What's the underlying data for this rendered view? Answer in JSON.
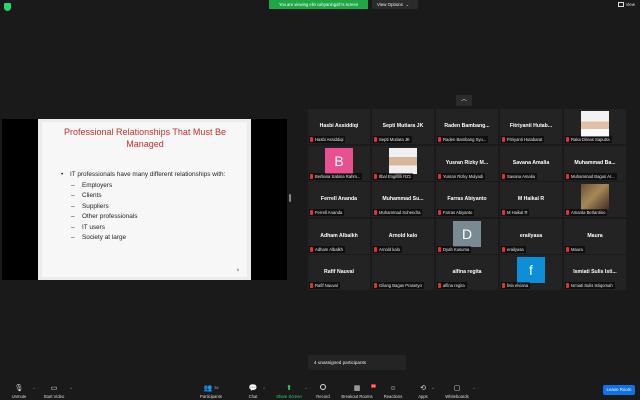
{
  "top": {
    "viewing_banner": "You are viewing elin cahyaningsih's screen",
    "view_options": "View Options",
    "view": "View"
  },
  "slide": {
    "title": "Professional Relationships That Must Be Managed",
    "bullet": "IT professionals have many different relationships with:",
    "items": [
      "Employers",
      "Clients",
      "Suppliers",
      "Other professionals",
      "IT users",
      "Society at large"
    ],
    "page_number": "6"
  },
  "tiles": [
    {
      "name": "Hasbi Assiddiqi",
      "label": "Hasbi Assiddiqi"
    },
    {
      "name": "Septi Mutiara JK",
      "label": "Septi Mutiara JK"
    },
    {
      "name": "Raden Bambang...",
      "label": "Raden Bambang Syu..."
    },
    {
      "name": "Fitriyanti Hutab...",
      "label": "Fitriyanti Hutabarat"
    },
    {
      "name": "",
      "label": "Raka Dimas Saputra",
      "avatar": "photo"
    },
    {
      "name": "",
      "label": "Berliana Sabina Rahm...",
      "avatar": "initial",
      "initial": "B"
    },
    {
      "name": "",
      "label": "Ilbal Engilfilli RZ1",
      "avatar": "photo"
    },
    {
      "name": "Yusran Rizky M...",
      "label": "Yusran Rizky Mulyadi"
    },
    {
      "name": "Savana Amalia",
      "label": "Savana Amalia"
    },
    {
      "name": "Muhammad Ba...",
      "label": "Muhammad Bagus Ar..."
    },
    {
      "name": "Ferrell Ananda",
      "label": "Ferrell Ananda"
    },
    {
      "name": "Muhammad Su...",
      "label": "Muhammad Suhendra"
    },
    {
      "name": "Farras Abiyanto",
      "label": "Farras Abiyanto"
    },
    {
      "name": "M Haikal R",
      "label": "M Haikal R"
    },
    {
      "name": "",
      "label": "Amanta Berlantino",
      "avatar": "photo"
    },
    {
      "name": "Adham Albalkh",
      "label": "Adham Albalkh"
    },
    {
      "name": "Arnold kalo",
      "label": "Arnold kalo"
    },
    {
      "name": "",
      "label": "Dyah Kusuma",
      "avatar": "initial",
      "initial": "D"
    },
    {
      "name": "erailyasa",
      "label": "erailyasa"
    },
    {
      "name": "Maura",
      "label": "Maura"
    },
    {
      "name": "Rafif Nauval",
      "label": "Rafif Nauval"
    },
    {
      "name": "",
      "label": "Gilang Bagas Prasetyo"
    },
    {
      "name": "alfina regita",
      "label": "alfina regita"
    },
    {
      "name": "",
      "label": "fela elviana",
      "avatar": "initial",
      "initial": "f"
    },
    {
      "name": "Ismiati Sulis Isti...",
      "label": "Ismiati Sulis Istiqomah"
    }
  ],
  "unassigned": "4 unassigned participants",
  "toolbar": {
    "unmute": "Unmute",
    "start_video": "Start Video",
    "participants": "Participants",
    "participants_count": "38",
    "chat": "Chat",
    "share_screen": "Share Screen",
    "record": "Record",
    "breakout_rooms": "Breakout Rooms",
    "breakout_badge": "19",
    "reactions": "Reactions",
    "apps": "Apps",
    "whiteboards": "Whiteboards",
    "leave_room": "Leave Room"
  }
}
